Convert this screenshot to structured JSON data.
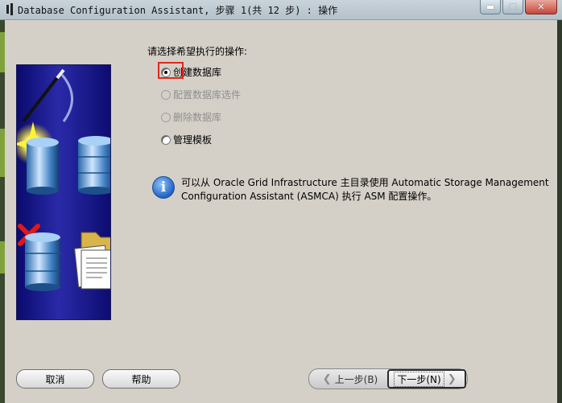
{
  "window": {
    "title": "Database Configuration Assistant, 步骤 1(共 12 步) : 操作",
    "controls": [
      "minimize",
      "maximize",
      "close"
    ]
  },
  "main": {
    "prompt": "请选择希望执行的操作:",
    "options": [
      {
        "label": "创建数据库",
        "selected": true,
        "enabled": true
      },
      {
        "label": "配置数据库选件",
        "selected": false,
        "enabled": false
      },
      {
        "label": "删除数据库",
        "selected": false,
        "enabled": false
      },
      {
        "label": "管理模板",
        "selected": false,
        "enabled": true
      }
    ],
    "info_text": "可以从 Oracle Grid Infrastructure 主目录使用 Automatic Storage Management Configuration Assistant (ASMCA) 执行 ASM 配置操作。"
  },
  "footer": {
    "cancel_label": "取消",
    "help_label": "帮助",
    "back_label": "上一步(B)",
    "next_label": "下一步(N)"
  },
  "colors": {
    "dialog_bg": "#d4d0c8",
    "highlight": "#e2261d",
    "illustration_bg": "#1a1a8c"
  }
}
